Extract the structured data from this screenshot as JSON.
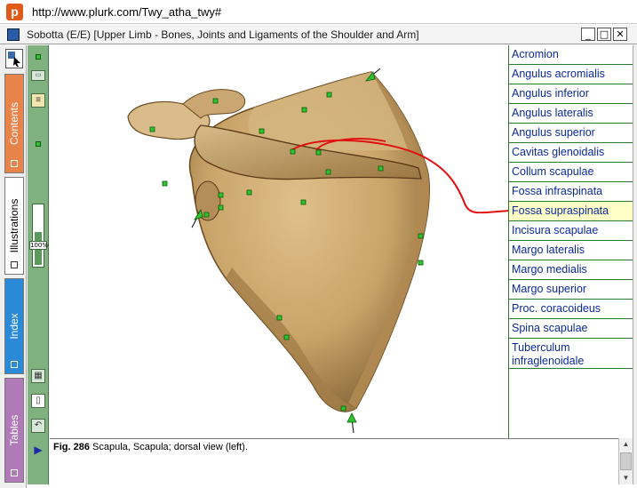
{
  "browser": {
    "url": "http://www.plurk.com/Twy_atha_twy#"
  },
  "window": {
    "title": "Sobotta (E/E)  [Upper Limb  -  Bones, Joints and Ligaments of the Shoulder and Arm]",
    "minimize_label": "_",
    "maximize_label": "□",
    "close_label": "✕"
  },
  "side_tabs": [
    {
      "label": "Contents",
      "color": "#e8834a"
    },
    {
      "label": "Illustrations",
      "color": "#ffffff"
    },
    {
      "label": "Index",
      "color": "#2a8ad8"
    },
    {
      "label": "Tables",
      "color": "#b07ab8"
    }
  ],
  "zoom": {
    "label": "100%",
    "level": 0.55
  },
  "labels": [
    {
      "text": "Acromion",
      "selected": false
    },
    {
      "text": "Angulus acromialis",
      "selected": false
    },
    {
      "text": "Angulus inferior",
      "selected": false
    },
    {
      "text": "Angulus lateralis",
      "selected": false
    },
    {
      "text": "Angulus superior",
      "selected": false
    },
    {
      "text": "Cavitas glenoidalis",
      "selected": false
    },
    {
      "text": "Collum scapulae",
      "selected": false
    },
    {
      "text": "Fossa infraspinata",
      "selected": false
    },
    {
      "text": "Fossa supraspinata",
      "selected": true
    },
    {
      "text": "Incisura scapulae",
      "selected": false
    },
    {
      "text": "Margo lateralis",
      "selected": false
    },
    {
      "text": "Margo medialis",
      "selected": false
    },
    {
      "text": "Margo superior",
      "selected": false
    },
    {
      "text": "Proc. coracoideus",
      "selected": false
    },
    {
      "text": "Spina scapulae",
      "selected": false
    },
    {
      "text": "Tuberculum infraglenoidale",
      "selected": false
    }
  ],
  "caption": {
    "fig_number": "Fig. 286",
    "text": "Scapula, Scapula; dorsal view (left)."
  },
  "colors": {
    "bone": "#c9a46a",
    "bone_dark": "#8a6a3a",
    "annotation_line": "#e01010",
    "marker": "#2fc42f",
    "label_text": "#0a2a9a",
    "selected_bg": "#ffffc8",
    "divider": "#2f7a2f"
  },
  "icons": {
    "app": "sobotta-app-icon",
    "url_site": "plurk-icon",
    "pointer_tool": "pointer-tool-icon",
    "print": "print-icon",
    "notes": "notes-icon",
    "grid": "grid-icon",
    "page": "page-icon",
    "undo": "undo-icon",
    "play": "play-icon"
  }
}
